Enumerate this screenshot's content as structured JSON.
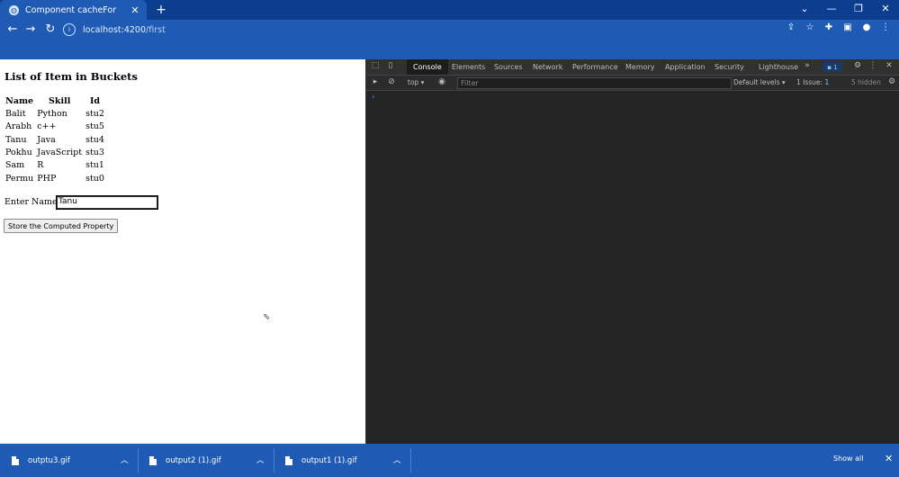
{
  "browser": {
    "tab_title": "Component cacheFor",
    "url_host": "localhost:4200",
    "url_path": "/first"
  },
  "page": {
    "heading": "List of Item in Buckets",
    "table": {
      "headers": [
        "Name",
        "Skill",
        "Id"
      ],
      "rows": [
        [
          "Balit",
          "Python",
          "stu2"
        ],
        [
          "Arabh",
          "c++",
          "stu5"
        ],
        [
          "Tanu",
          "Java",
          "stu4"
        ],
        [
          "Pokhu",
          "JavaScript",
          "stu3"
        ],
        [
          "Sam",
          "R",
          "stu1"
        ],
        [
          "Permu",
          "PHP",
          "stu0"
        ]
      ]
    },
    "name_label": "Enter Name :",
    "name_value": "Tanu",
    "store_button": "Store the Computed Property"
  },
  "devtools": {
    "tabs": [
      "Console",
      "Elements",
      "Sources",
      "Network",
      "Performance",
      "Memory",
      "Application",
      "Security",
      "Lighthouse"
    ],
    "issue_badge": "1",
    "context": "top",
    "filter_placeholder": "Filter",
    "levels": "Default levels",
    "issues": "1 Issue:",
    "issues_count": "1",
    "hidden": "5 hidden"
  },
  "downloads": {
    "items": [
      "outptu3.gif",
      "output2 (1).gif",
      "output1 (1).gif"
    ],
    "show_all": "Show all"
  },
  "colors": {
    "chrome_blue": "#1f5bb5",
    "tabstrip": "#0d3d8f",
    "devtools_bg": "#242424"
  }
}
